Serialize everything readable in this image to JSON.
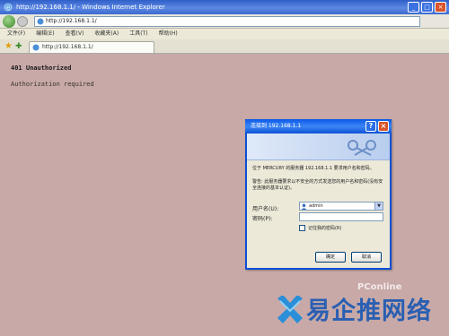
{
  "window": {
    "title": "http://192.168.1.1/ - Windows Internet Explorer"
  },
  "address_bar": {
    "url": "http://192.168.1.1/"
  },
  "menu": [
    "文件(F)",
    "编辑(E)",
    "查看(V)",
    "收藏夹(A)",
    "工具(T)",
    "帮助(H)"
  ],
  "tab": {
    "label": "http://192.168.1.1/"
  },
  "page": {
    "heading": "401 Unauthorized",
    "text": "Authorization required"
  },
  "dialog": {
    "title": "连接到 192.168.1.1",
    "message1": "位于 MERCURY 的服务器 192.168.1.1 要求用户名和密码。",
    "message2": "警告: 此服务器要求以不安全的方式发送您的用户名和密码(没有安全连接的基本认证)。",
    "username_label": "用户名(U):",
    "username_value": "admin",
    "password_label": "密码(P):",
    "remember_label": "记住我的密码(R)",
    "ok_label": "确定",
    "cancel_label": "取消"
  },
  "watermark": {
    "brand": "易企推网络",
    "pconline": "PConline"
  },
  "colors": {
    "page_bg": "#c8a9a7",
    "titlebar": "#2f5fc8",
    "dialog_title": "#0a58e8",
    "watermark": "#2a5fb2"
  }
}
